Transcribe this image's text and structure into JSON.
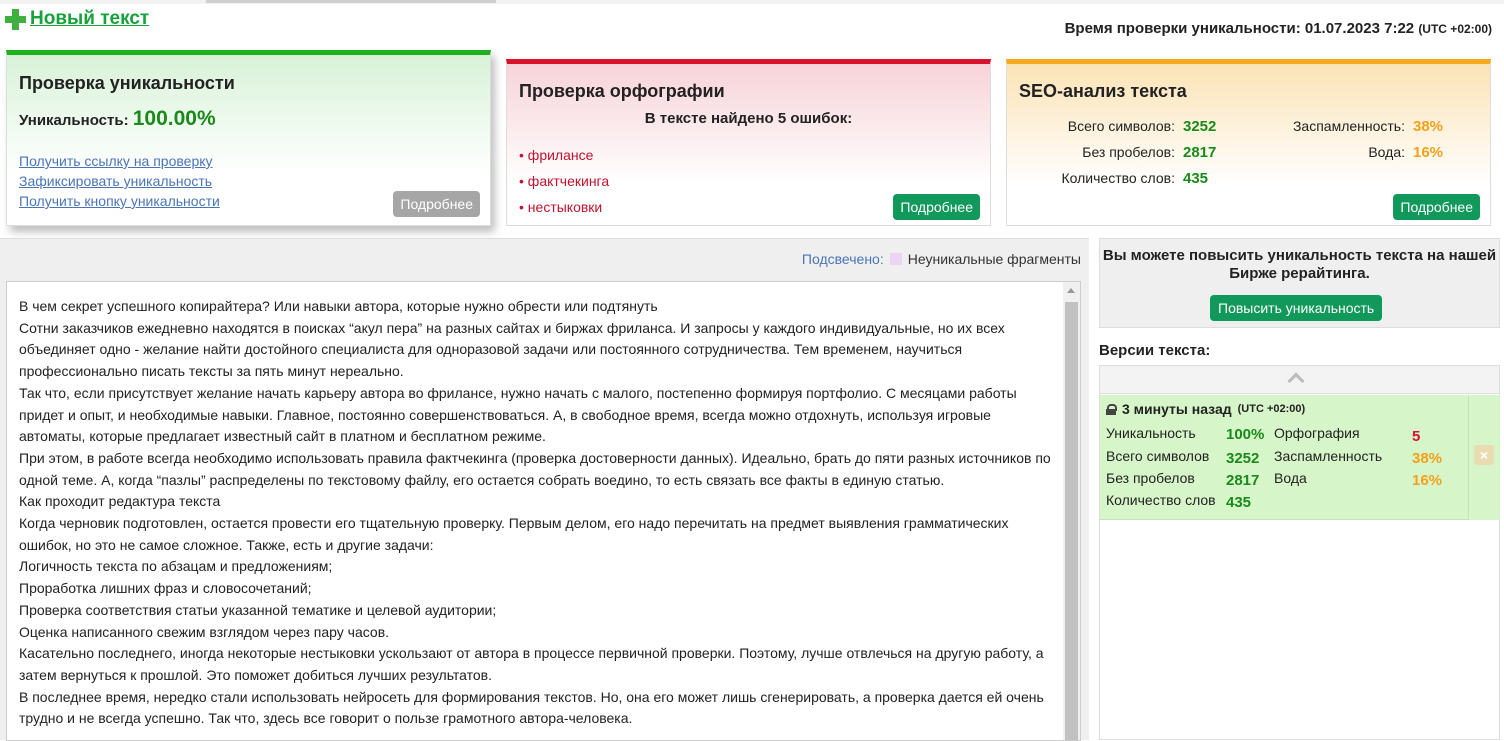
{
  "header": {
    "new_text_label": "Новый текст",
    "check_time_label": "Время проверки уникальности: 01.07.2023 7:22",
    "check_time_tz": "(UTC +02:00)"
  },
  "uniqueness_card": {
    "title": "Проверка уникальности",
    "label": "Уникальность:",
    "value": "100.00%",
    "links": [
      "Получить ссылку на проверку",
      "Зафиксировать уникальность",
      "Получить кнопку уникальности"
    ],
    "more_button": "Подробнее"
  },
  "spelling_card": {
    "title": "Проверка орфографии",
    "found_text": "В тексте найдено 5 ошибок:",
    "errors": [
      "фрилансе",
      "фактчекинга",
      "нестыковки"
    ],
    "more_button": "Подробнее"
  },
  "seo_card": {
    "title": "SEO-анализ текста",
    "total_chars_label": "Всего символов:",
    "total_chars": "3252",
    "no_spaces_label": "Без пробелов:",
    "no_spaces": "2817",
    "word_count_label": "Количество слов:",
    "word_count": "435",
    "spam_label": "Заспамленность:",
    "spam": "38%",
    "water_label": "Вода:",
    "water": "16%",
    "more_button": "Подробнее"
  },
  "text_panel": {
    "highlight_label": "Подсвечено:",
    "highlight_legend": "Неуникальные фрагменты",
    "paragraphs": [
      "В чем секрет успешного копирайтера? Или навыки автора, которые нужно обрести или подтянуть",
      "Сотни заказчиков ежедневно находятся в поисках “акул пера” на разных сайтах и биржах фриланса. И запросы у каждого индивидуальные, но их всех объединяет одно - желание найти достойного специалиста для одноразовой задачи или постоянного сотрудничества. Тем временем, научиться профессионально писать тексты за пять минут нереально.",
      "Так что, если присутствует желание начать карьеру автора во фрилансе, нужно начать с малого, постепенно формируя портфолио. С месяцами работы придет и опыт, и необходимые навыки. Главное, постоянно совершенствоваться. А, в свободное время, всегда можно отдохнуть, используя игровые автоматы, которые предлагает известный сайт в платном и бесплатном режиме.",
      "При этом, в работе всегда необходимо использовать правила фактчекинга (проверка достоверности данных). Идеально, брать до пяти разных источников по одной теме. А, когда “пазлы” распределены по текстовому файлу, его остается собрать воедино, то есть связать все факты в единую статью.",
      "Как проходит редактура текста",
      "Когда черновик подготовлен, остается провести его тщательную проверку. Первым делом, его надо перечитать на предмет выявления грамматических ошибок, но это не самое сложное. Также, есть и другие задачи:",
      "Логичность текста по абзацам и предложениям;",
      "Проработка лишних фраз и словосочетаний;",
      "Проверка соответствия статьи указанной тематике и целевой аудитории;",
      "Оценка написанного свежим взглядом через пару часов.",
      "Касательно последнего, иногда некоторые нестыковки ускользают от автора в процессе первичной проверки. Поэтому, лучше отвлечься на другую работу, а затем вернуться к прошлой. Это поможет добиться лучших результатов.",
      "В последнее время, нередко стали использовать нейросеть для формирования текстов. Но, она его может лишь сгенерировать, а проверка дается ей очень трудно и не всегда успешно. Так что, здесь все говорит о пользе грамотного автора-человека."
    ]
  },
  "promo": {
    "text": "Вы можете повысить уникальность текста на нашей Бирже рерайтинга.",
    "button": "Повысить уникальность"
  },
  "versions": {
    "title": "Версии текста:",
    "items": [
      {
        "time": "3 минуты назад",
        "tz": "(UTC +02:00)",
        "uniq_label": "Уникальность",
        "uniq": "100%",
        "spell_label": "Орфография",
        "spell": "5",
        "total_label": "Всего символов",
        "total": "3252",
        "spam_label": "Заспамленность",
        "spam": "38%",
        "nospace_label": "Без пробелов",
        "nospace": "2817",
        "water_label": "Вода",
        "water": "16%",
        "words_label": "Количество слов",
        "words": "435",
        "delete_glyph": "×"
      }
    ]
  },
  "colors": {
    "accent_green": "#10995a",
    "uniq_border": "#1db31d",
    "spell_border": "#d8122d",
    "seo_border": "#f4aa1c"
  }
}
